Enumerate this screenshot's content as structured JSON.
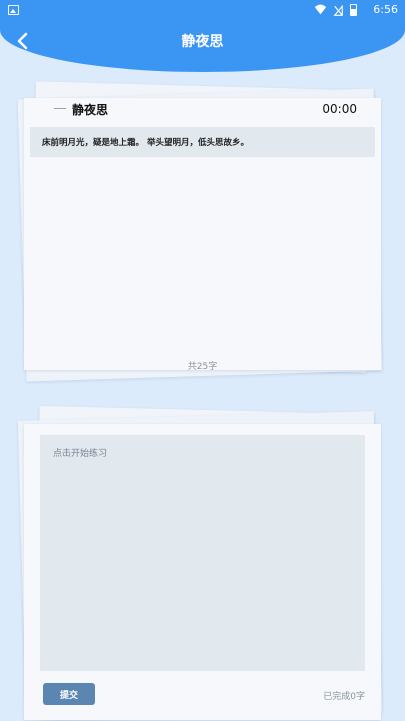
{
  "status_bar": {
    "time": "6:56"
  },
  "header": {
    "title": "静夜思"
  },
  "poem": {
    "title": "静夜思",
    "timer": "00:00",
    "text": "床前明月光，疑是地上霜。 举头望明月，低头思故乡。",
    "char_count": "共25字"
  },
  "practice": {
    "hint": "点击开始练习",
    "submit_label": "提交",
    "progress": "已完成0字"
  },
  "colors": {
    "accent": "#3b95f3",
    "button": "#5b86b1",
    "background": "#dcebfb"
  }
}
